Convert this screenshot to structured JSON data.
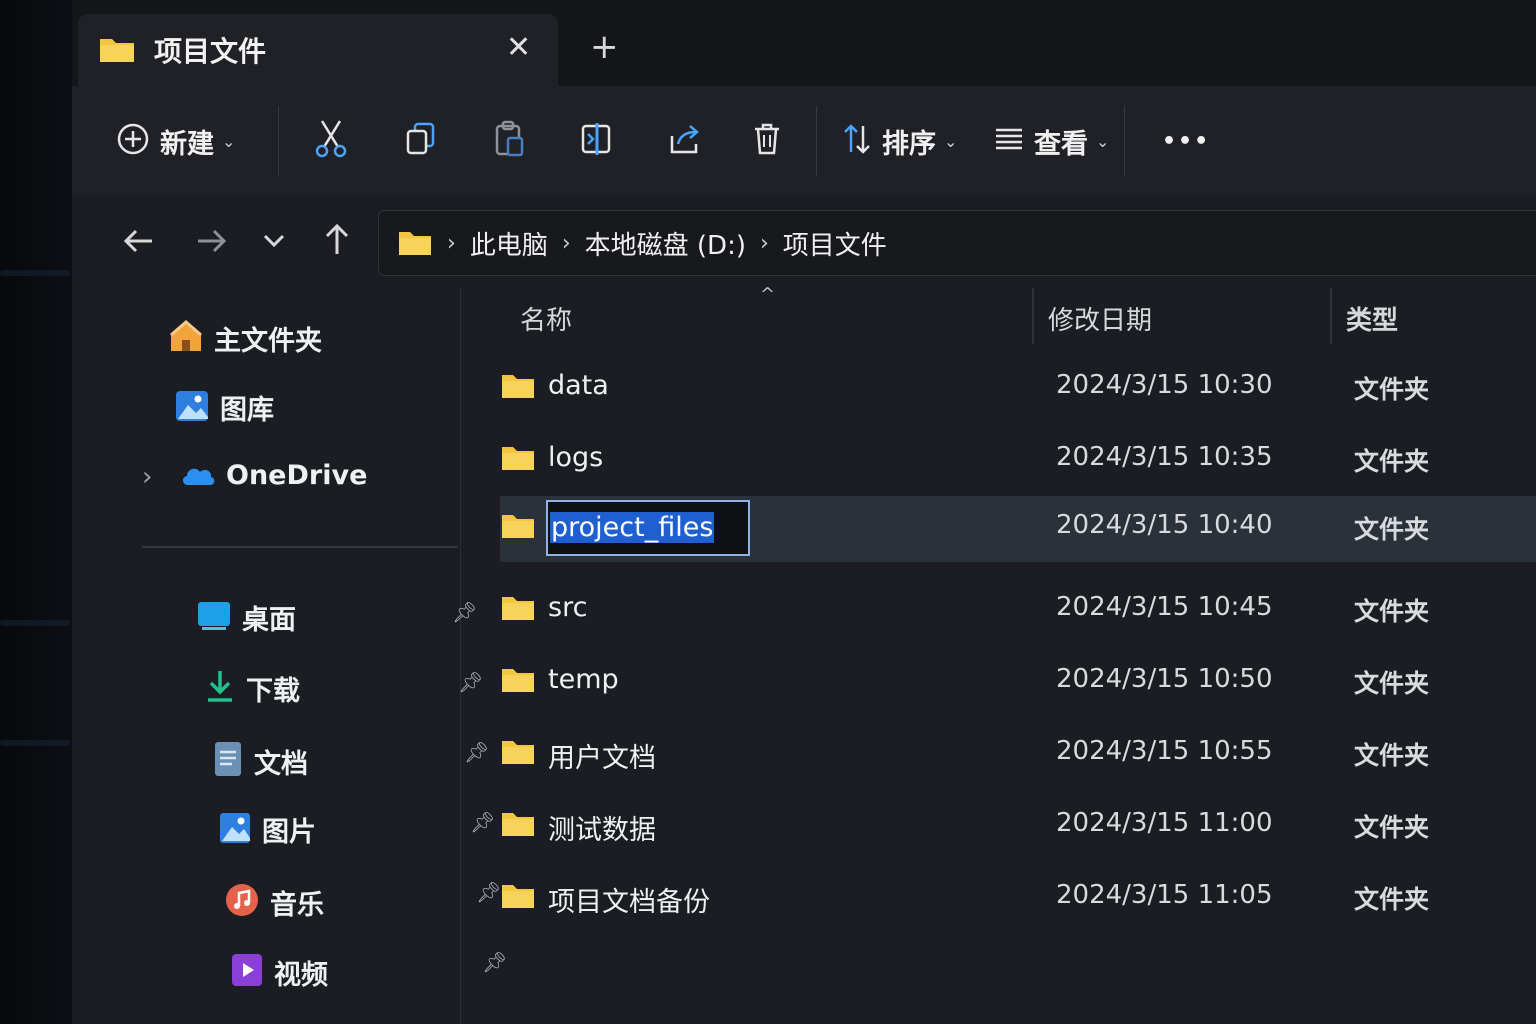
{
  "tab": {
    "title": "项目文件",
    "close_glyph": "✕",
    "new_glyph": "+"
  },
  "toolbar": {
    "new_label": "新建",
    "sort_label": "排序",
    "view_label": "查看",
    "more_glyph": "•••"
  },
  "nav": {
    "breadcrumbs": [
      "此电脑",
      "本地磁盘 (D:)",
      "项目文件"
    ],
    "sep": "›"
  },
  "sidebar": {
    "home": "主文件夹",
    "gallery": "图库",
    "onedrive": "OneDrive",
    "expand_glyph": "›",
    "pinned": [
      "桌面",
      "下载",
      "文档",
      "图片",
      "音乐",
      "视频"
    ]
  },
  "columns": {
    "name": "名称",
    "modified": "修改日期",
    "type": "类型",
    "sort_glyph": "^"
  },
  "files": [
    {
      "name": "data",
      "modified": "2024/3/15 10:30",
      "type": "文件夹"
    },
    {
      "name": "logs",
      "modified": "2024/3/15 10:35",
      "type": "文件夹"
    },
    {
      "name": "project_files",
      "modified": "2024/3/15 10:40",
      "type": "文件夹",
      "renaming": true
    },
    {
      "name": "src",
      "modified": "2024/3/15 10:45",
      "type": "文件夹"
    },
    {
      "name": "temp",
      "modified": "2024/3/15 10:50",
      "type": "文件夹"
    },
    {
      "name": "用户文档",
      "modified": "2024/3/15 10:55",
      "type": "文件夹"
    },
    {
      "name": "测试数据",
      "modified": "2024/3/15 11:00",
      "type": "文件夹"
    },
    {
      "name": "项目文档备份",
      "modified": "2024/3/15 11:05",
      "type": "文件夹"
    }
  ],
  "colors": {
    "accent": "#1f5fcf",
    "folder": "#f4c542",
    "selection": "#2b3138"
  }
}
